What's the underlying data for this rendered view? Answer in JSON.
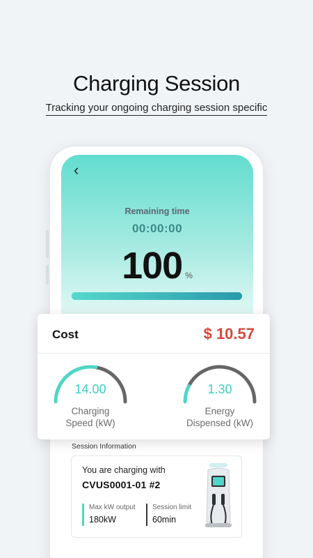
{
  "hero": {
    "title": "Charging Session",
    "subtitle": "Tracking your ongoing charging session specific"
  },
  "screen": {
    "back_icon": "chevron-left-icon",
    "remaining_label": "Remaining time",
    "remaining_value": "00:00:00",
    "percent_value": "100",
    "percent_unit": "%",
    "progress_fraction": 1.0
  },
  "cost_card": {
    "label": "Cost",
    "value": "$ 10.57",
    "gauges": [
      {
        "value": "14.00",
        "label_line1": "Charging",
        "label_line2": "Speed (kW)",
        "fill_fraction": 0.55
      },
      {
        "value": "1.30",
        "label_line1": "Energy",
        "label_line2": "Dispensed (kW)",
        "fill_fraction": 0.15
      }
    ]
  },
  "session": {
    "title": "Session Information",
    "line1": "You are charging with",
    "station": "CVUS0001-01 #2",
    "stats": [
      {
        "label": "Max kW output",
        "value": "180kW"
      },
      {
        "label": "Session limit",
        "value": "60min"
      }
    ],
    "charger_icon": "ev-charger-icon"
  },
  "colors": {
    "accent": "#4fd6c6",
    "cost": "#d9463c",
    "gauge_track": "#666666",
    "background": "#f1f4f7"
  }
}
